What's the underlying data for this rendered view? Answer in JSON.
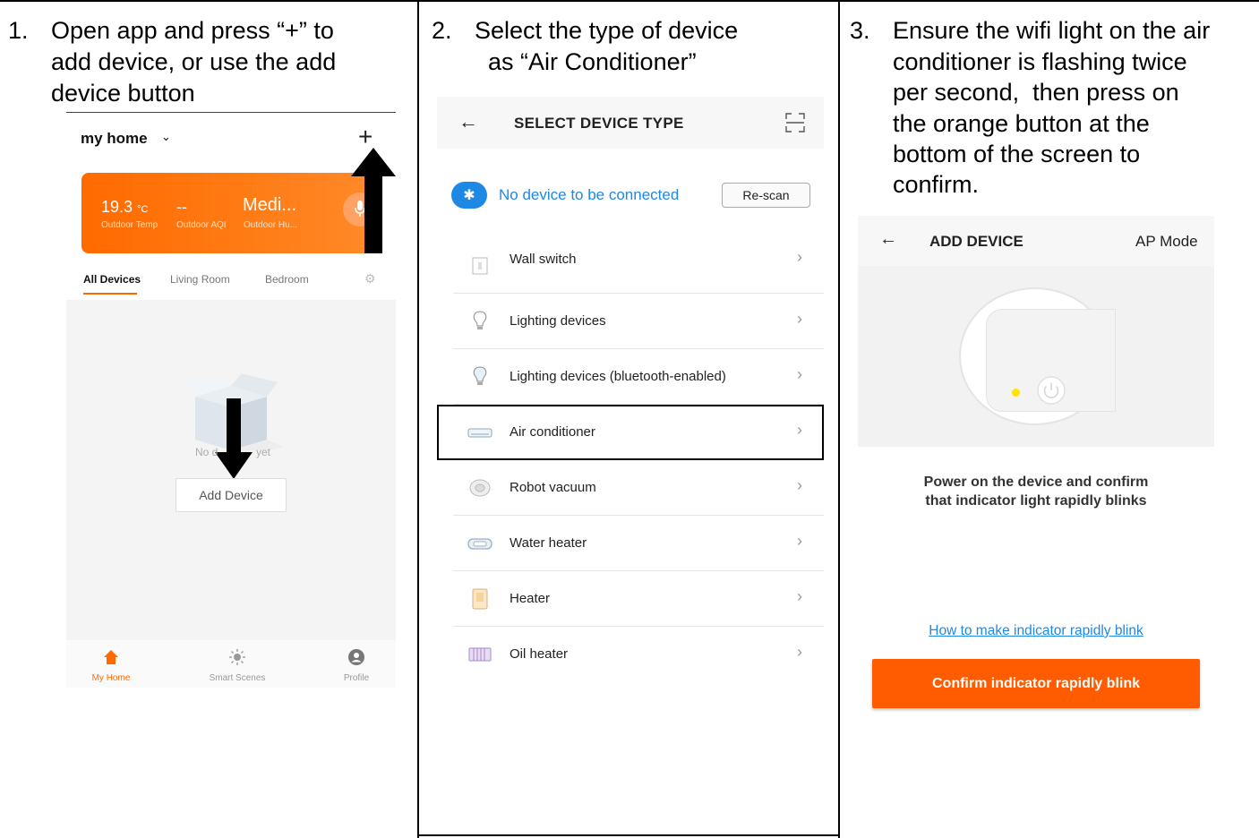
{
  "steps": [
    {
      "num": "1.",
      "lines": [
        "Open app and press “+” to",
        "add device, or use the add",
        "device button"
      ]
    },
    {
      "num": "2.",
      "lines": [
        "Select the type of device",
        "  as “Air Conditioner”"
      ]
    },
    {
      "num": "3.",
      "lines": [
        "Ensure the wifi light on the air",
        "conditioner is flashing twice",
        "per second,  then press on",
        "the orange button at the",
        "bottom of the screen to",
        "confirm."
      ]
    }
  ],
  "panel1": {
    "home_title": "my home",
    "weather": {
      "temp": "19.3",
      "temp_unit": "°C",
      "aqi": "--",
      "humidity": "Medi...",
      "temp_label": "Outdoor Temp",
      "aqi_label": "Outdoor AQI",
      "hum_label": "Outdoor Hu..."
    },
    "tabs": [
      "All Devices",
      "Living Room",
      "Bedroom"
    ],
    "empty_text_start": "No d",
    "empty_text_end": "yet",
    "add_device_label": "Add Device",
    "nav": [
      "My Home",
      "Smart Scenes",
      "Profile"
    ]
  },
  "panel2": {
    "title": "SELECT DEVICE TYPE",
    "bt_status": "No device to be connected",
    "rescan_label": "Re-scan",
    "devices": [
      "Wall switch",
      "Lighting devices",
      "Lighting devices (bluetooth-enabled)",
      "Air conditioner",
      "Robot vacuum",
      "Water heater",
      "Heater",
      "Oil heater"
    ],
    "highlighted": "Air conditioner"
  },
  "panel3": {
    "title": "ADD DEVICE",
    "mode": "AP Mode",
    "message_lines": [
      "Power on the device and confirm",
      "that indicator light rapidly blinks"
    ],
    "link": "How to make indicator rapidly blink",
    "confirm_label": "Confirm indicator rapidly blink"
  },
  "colors": {
    "accent_orange": "#ff5b00",
    "link_blue": "#1e88e5",
    "led_yellow": "#ffe400"
  }
}
